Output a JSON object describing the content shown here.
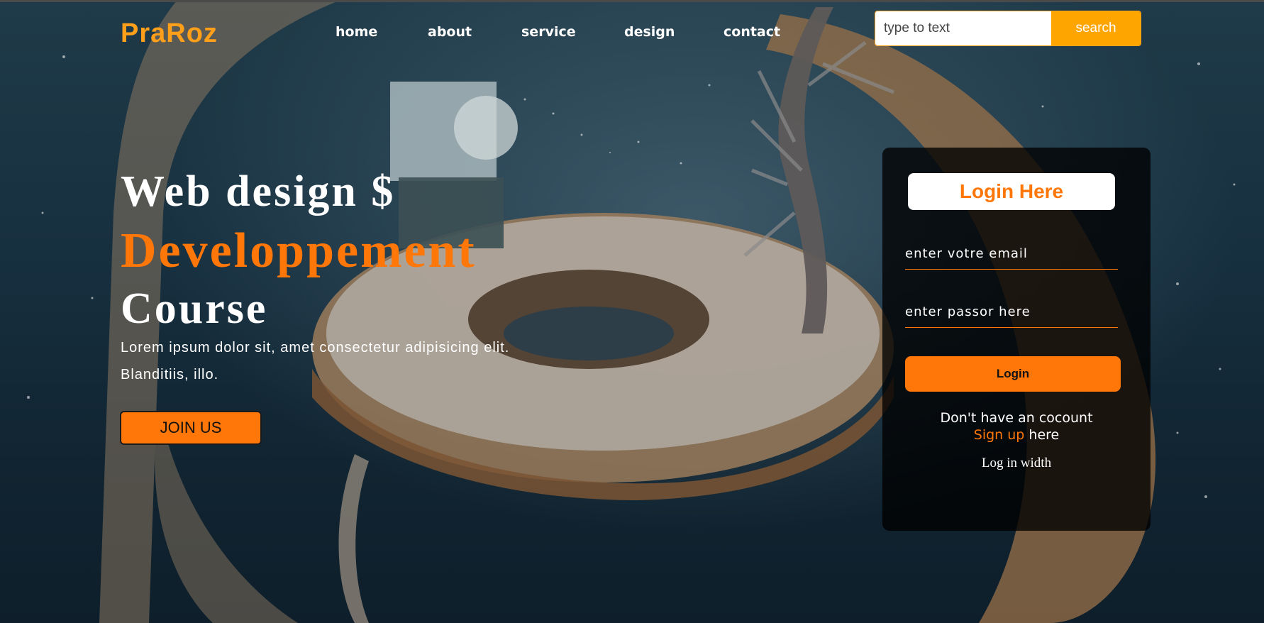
{
  "brand": {
    "logo": "PraRoz"
  },
  "nav": {
    "items": [
      {
        "label": "home"
      },
      {
        "label": "about"
      },
      {
        "label": "service"
      },
      {
        "label": "design"
      },
      {
        "label": "contact"
      }
    ]
  },
  "search": {
    "placeholder": "type to text",
    "button_label": "search"
  },
  "hero": {
    "line1": "Web design $",
    "line2": "Developpement",
    "line3": "Course",
    "para1": "Lorem ipsum dolor sit, amet consectetur adipisicing elit.",
    "para2": "Blanditiis, illo.",
    "join_label": "JOIN US"
  },
  "login": {
    "title": "Login Here",
    "email_placeholder": "enter votre email",
    "password_placeholder": "enter passor here",
    "button_label": "Login",
    "no_account_text": "Don't have an cocount",
    "signup_link": "Sign up",
    "signup_suffix": " here",
    "log_in_with": "Log in width"
  },
  "colors": {
    "accent": "#ff7708",
    "logo": "#ff9f1a",
    "search_button": "#ffa500"
  }
}
